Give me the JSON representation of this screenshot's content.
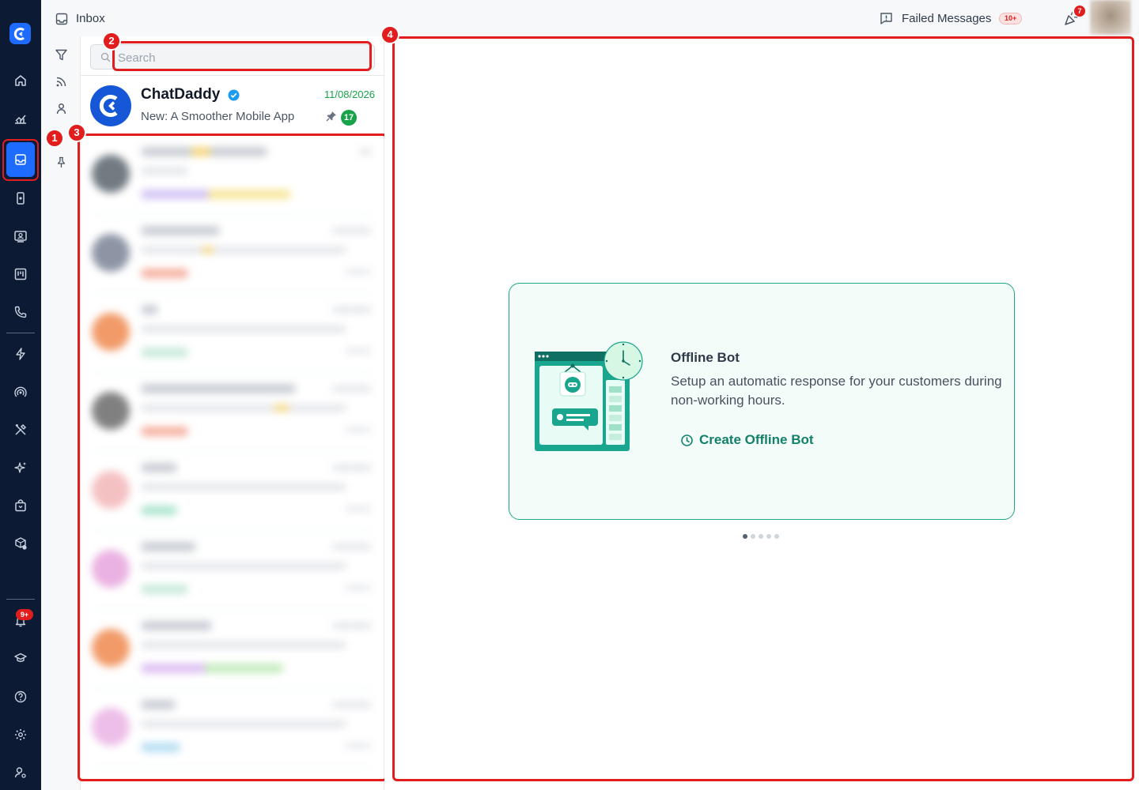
{
  "topbar": {
    "title": "Inbox",
    "failed_label": "Failed Messages",
    "failed_badge": "10+",
    "party_badge": "7"
  },
  "nav": {
    "notification_badge": "9+",
    "active_item": "inbox"
  },
  "filters": [
    "filter-icon",
    "feed-icon",
    "person-icon",
    "pin-icon"
  ],
  "search": {
    "placeholder": "Search",
    "value": ""
  },
  "pinned_chat": {
    "name": "ChatDaddy",
    "date": "11/08/2026",
    "message": "New: A Smoother Mobile App",
    "unread": "17"
  },
  "markers": [
    "1",
    "2",
    "3",
    "4"
  ],
  "offline_card": {
    "title": "Offline Bot",
    "description": "Setup an automatic response for your customers during non-working hours.",
    "link_label": "Create Offline Bot"
  },
  "carousel": {
    "active_index": 0,
    "count": 5
  },
  "colors": {
    "sidebar_bg": "#0c1a33",
    "brand_blue": "#1e6bff",
    "accent_green": "#13806a",
    "highlight_red": "#e11d1d"
  }
}
